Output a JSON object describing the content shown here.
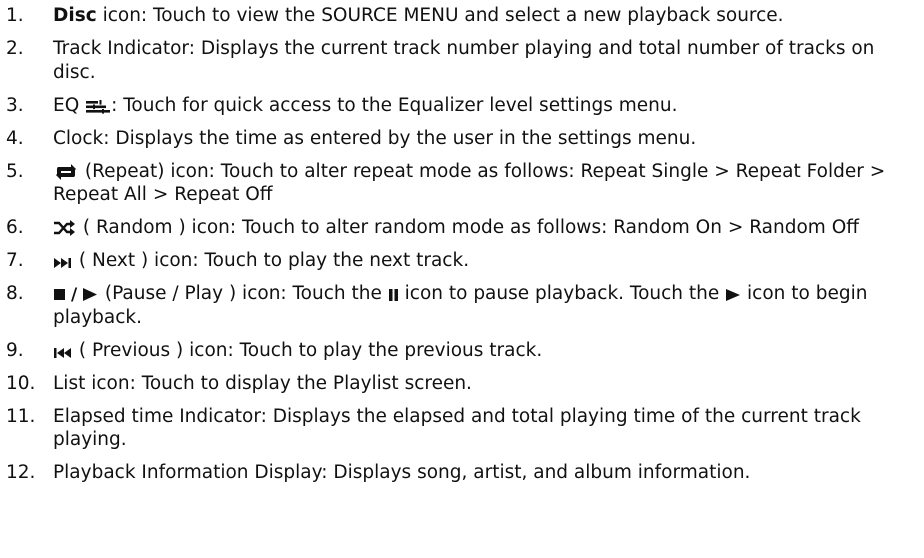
{
  "items": [
    {
      "num": "1.",
      "pre": "",
      "bold": "Disc",
      "text": " icon: Touch to view the SOURCE MENU and select a new playback source."
    },
    {
      "num": "2.",
      "pre": "",
      "text": "Track Indicator: Displays the current track number playing and total number of tracks on disc."
    },
    {
      "num": "3.",
      "pre": "EQ ",
      "icon": "eq-icon",
      "text": ": Touch for quick access to the Equalizer level settings menu."
    },
    {
      "num": "4.",
      "pre": "",
      "text": "Clock: Displays the time as entered by the user in the settings menu."
    },
    {
      "num": "5.",
      "pre": "",
      "icon": "repeat-icon",
      "text": " (Repeat) icon: Touch to alter repeat mode as follows: Repeat Single > Repeat Folder > Repeat All > Repeat Off"
    },
    {
      "num": "6.",
      "pre": "",
      "icon": "random-icon",
      "text": " ( Random ) icon: Touch to alter random mode as follows: Random On > Random Off"
    },
    {
      "num": "7.",
      "pre": "",
      "icon": "next-icon",
      "text": " ( Next ) icon: Touch to play the next track."
    },
    {
      "num": "8.",
      "pre": "",
      "icon": "pause-play-icon",
      "text": " (Pause / Play ) icon: Touch the ",
      "icon2": "pause-icon",
      "text2": " icon to pause playback. Touch the ",
      "icon3": "play-icon",
      "text3": " icon to begin playback."
    },
    {
      "num": "9.",
      "pre": "",
      "icon": "previous-icon",
      "text": " ( Previous ) icon: Touch to play the previous track."
    },
    {
      "num": "10.",
      "pre": "",
      "text": "List icon: Touch to display the Playlist screen."
    },
    {
      "num": "11.",
      "pre": "",
      "text": "Elapsed time Indicator: Displays the elapsed and total playing time of the current track playing."
    },
    {
      "num": "12.",
      "pre": "",
      "text": "Playback Information Display: Displays song, artist, and album information."
    }
  ],
  "pause_play_separator": "/"
}
